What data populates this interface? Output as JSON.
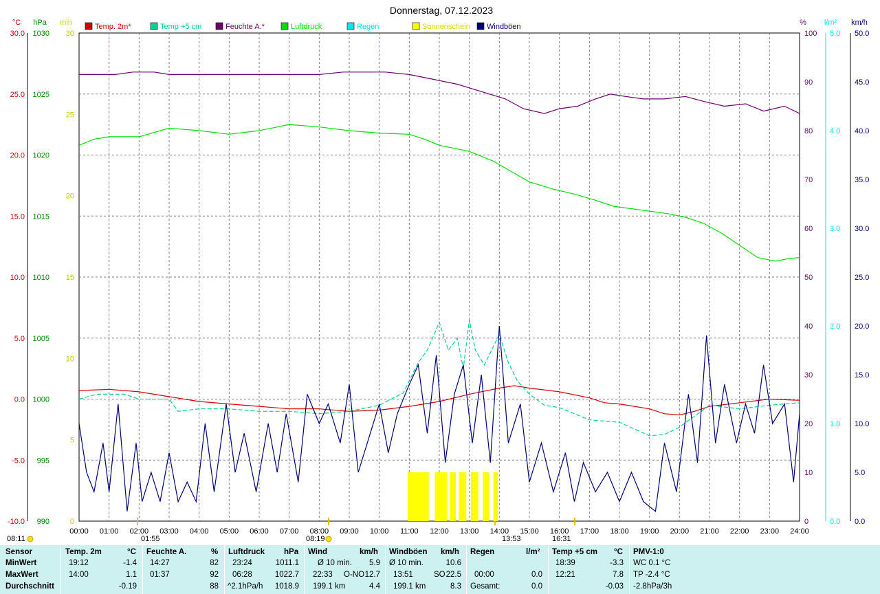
{
  "title": "Donnerstag, 07.12.2023",
  "colors": {
    "temp2m": "#d40000",
    "temp5cm": "#00d28c",
    "feuchte": "#6a006a",
    "luftdruck": "#00e000",
    "regen": "#00e8e8",
    "sonnenschein": "#ffff00",
    "windboeen": "#00007a",
    "grid": "#808080",
    "panel_bg": "#cdf1f1"
  },
  "chart_data": {
    "type": "line",
    "title": "Donnerstag, 07.12.2023",
    "legend": [
      "Temp. 2m*",
      "Temp +5 cm",
      "Feuchte A.*",
      "Luftdruck",
      "Regen",
      "Sonnenschein",
      "Windböen"
    ],
    "x_ticks": [
      "00:00",
      "01:00",
      "02:00",
      "03:00",
      "04:00",
      "05:00",
      "06:00",
      "07:00",
      "08:00",
      "09:00",
      "10:00",
      "11:00",
      "12:00",
      "13:00",
      "14:00",
      "15:00",
      "16:00",
      "17:00",
      "18:00",
      "19:00",
      "20:00",
      "21:00",
      "22:00",
      "23:00",
      "24:00"
    ],
    "axes": {
      "temp_c": {
        "unit": "°C",
        "ticks": [
          "30.0",
          "25.0",
          "20.0",
          "15.0",
          "10.0",
          "5.0",
          "0.0",
          "-5.0",
          "-10.0"
        ],
        "range": [
          -10,
          30
        ]
      },
      "pressure_hpa": {
        "unit": "hPa",
        "ticks": [
          "1030",
          "1025",
          "1020",
          "1015",
          "1010",
          "1005",
          "1000",
          "995",
          "990"
        ],
        "range": [
          990,
          1030
        ]
      },
      "sun_min": {
        "unit": "min",
        "ticks": [
          "30",
          "25",
          "20",
          "15",
          "10",
          "5",
          "0"
        ],
        "range": [
          0,
          30
        ]
      },
      "humidity_pct": {
        "unit": "%",
        "ticks": [
          "100",
          "90",
          "80",
          "70",
          "60",
          "50",
          "40",
          "30",
          "20",
          "10",
          "0"
        ],
        "range": [
          0,
          100
        ]
      },
      "rain_lm2": {
        "unit": "l/m²",
        "ticks": [
          "5.0",
          "4.0",
          "3.0",
          "2.0",
          "1.0",
          "0.0"
        ],
        "range": [
          0,
          5
        ]
      },
      "wind_kmh": {
        "unit": "km/h",
        "ticks": [
          "50.0",
          "45.0",
          "40.0",
          "35.0",
          "30.0",
          "25.0",
          "20.0",
          "15.0",
          "10.0",
          "5.0",
          "0.0"
        ],
        "range": [
          0,
          50
        ]
      }
    },
    "markers": {
      "sunrise": "08:19",
      "sunset": "16:31",
      "sun_max": "13:53",
      "extra": "01:55",
      "start": "08:11"
    },
    "series": [
      {
        "name": "Feuchte A.*",
        "axis": "humidity_pct",
        "points": [
          [
            0,
            91.5
          ],
          [
            1.2,
            91.5
          ],
          [
            1.8,
            92
          ],
          [
            2.5,
            92
          ],
          [
            3,
            91.5
          ],
          [
            4,
            91.5
          ],
          [
            5,
            91.5
          ],
          [
            6,
            91.5
          ],
          [
            7,
            91.5
          ],
          [
            8,
            91.5
          ],
          [
            8.8,
            92
          ],
          [
            10.2,
            92
          ],
          [
            11,
            91.5
          ],
          [
            11.8,
            90.5
          ],
          [
            12.6,
            89.5
          ],
          [
            13.4,
            88
          ],
          [
            14.2,
            86.5
          ],
          [
            14.8,
            84.5
          ],
          [
            15.5,
            83.5
          ],
          [
            16,
            84.5
          ],
          [
            16.6,
            85
          ],
          [
            17.2,
            86.5
          ],
          [
            17.7,
            87.5
          ],
          [
            18.2,
            87
          ],
          [
            18.8,
            86.5
          ],
          [
            19.5,
            86.5
          ],
          [
            20.2,
            87
          ],
          [
            20.8,
            86
          ],
          [
            21.5,
            85
          ],
          [
            22.2,
            85.5
          ],
          [
            22.8,
            84
          ],
          [
            23.5,
            85
          ],
          [
            24,
            83.5
          ]
        ]
      },
      {
        "name": "Luftdruck",
        "axis": "pressure_hpa",
        "points": [
          [
            0,
            1020.8
          ],
          [
            0.5,
            1021.3
          ],
          [
            1,
            1021.5
          ],
          [
            2,
            1021.5
          ],
          [
            3,
            1022.2
          ],
          [
            4,
            1022
          ],
          [
            5,
            1021.7
          ],
          [
            6,
            1022
          ],
          [
            7,
            1022.5
          ],
          [
            8,
            1022.3
          ],
          [
            9,
            1022
          ],
          [
            10,
            1021.8
          ],
          [
            11,
            1021.7
          ],
          [
            11.5,
            1021.3
          ],
          [
            12,
            1020.8
          ],
          [
            13,
            1020.3
          ],
          [
            13.8,
            1019.5
          ],
          [
            14.5,
            1018.5
          ],
          [
            15,
            1017.8
          ],
          [
            15.8,
            1017.2
          ],
          [
            16.5,
            1016.8
          ],
          [
            17.2,
            1016.3
          ],
          [
            17.8,
            1015.8
          ],
          [
            18.4,
            1015.6
          ],
          [
            19,
            1015.4
          ],
          [
            19.6,
            1015.2
          ],
          [
            20.2,
            1014.9
          ],
          [
            20.8,
            1014.4
          ],
          [
            21.4,
            1013.6
          ],
          [
            22,
            1012.6
          ],
          [
            22.6,
            1011.6
          ],
          [
            23.2,
            1011.3
          ],
          [
            23.6,
            1011.5
          ],
          [
            24,
            1011.6
          ]
        ]
      },
      {
        "name": "Temp. 2m*",
        "axis": "temp_c",
        "points": [
          [
            0,
            0.7
          ],
          [
            1,
            0.8
          ],
          [
            2,
            0.6
          ],
          [
            3,
            0.2
          ],
          [
            4,
            -0.2
          ],
          [
            5,
            -0.4
          ],
          [
            6,
            -0.6
          ],
          [
            7,
            -0.8
          ],
          [
            8,
            -0.8
          ],
          [
            9,
            -1
          ],
          [
            10,
            -0.9
          ],
          [
            11,
            -0.6
          ],
          [
            12,
            -0.2
          ],
          [
            13,
            0.4
          ],
          [
            14,
            0.9
          ],
          [
            14.5,
            1.1
          ],
          [
            15,
            0.9
          ],
          [
            16,
            0.6
          ],
          [
            17,
            0.1
          ],
          [
            17.5,
            -0.3
          ],
          [
            18,
            -0.4
          ],
          [
            19,
            -0.8
          ],
          [
            19.5,
            -1.2
          ],
          [
            20,
            -1.3
          ],
          [
            20.5,
            -1
          ],
          [
            21,
            -0.6
          ],
          [
            22,
            -0.3
          ],
          [
            23,
            0
          ],
          [
            24,
            -0.1
          ]
        ]
      },
      {
        "name": "Temp +5 cm",
        "axis": "temp_c",
        "points": [
          [
            0,
            0
          ],
          [
            0.6,
            0.4
          ],
          [
            1.5,
            0.4
          ],
          [
            2,
            0
          ],
          [
            3,
            0
          ],
          [
            3.3,
            -1
          ],
          [
            4,
            -0.8
          ],
          [
            5,
            -0.8
          ],
          [
            6,
            -1
          ],
          [
            7,
            -1
          ],
          [
            8,
            -1.2
          ],
          [
            9,
            -1
          ],
          [
            10,
            -0.5
          ],
          [
            10.8,
            0.5
          ],
          [
            11.3,
            3
          ],
          [
            11.6,
            4
          ],
          [
            12,
            6.3
          ],
          [
            12.3,
            4
          ],
          [
            12.6,
            5
          ],
          [
            12.8,
            2.5
          ],
          [
            13,
            6.5
          ],
          [
            13.2,
            4
          ],
          [
            13.5,
            2.8
          ],
          [
            14,
            5.3
          ],
          [
            14.3,
            3
          ],
          [
            14.6,
            1.5
          ],
          [
            15,
            0.4
          ],
          [
            15.5,
            -0.5
          ],
          [
            16,
            -0.7
          ],
          [
            16.5,
            -1.2
          ],
          [
            17,
            -1.7
          ],
          [
            18,
            -1.9
          ],
          [
            19,
            -3
          ],
          [
            19.5,
            -2.9
          ],
          [
            20,
            -2.3
          ],
          [
            21,
            -0.5
          ],
          [
            22,
            -0.8
          ],
          [
            23,
            -0.5
          ],
          [
            24,
            -0.3
          ]
        ]
      },
      {
        "name": "Windböen",
        "axis": "wind_kmh",
        "points": [
          [
            0,
            10
          ],
          [
            0.25,
            5
          ],
          [
            0.5,
            3
          ],
          [
            0.8,
            8
          ],
          [
            1,
            3
          ],
          [
            1.3,
            12
          ],
          [
            1.6,
            1
          ],
          [
            1.9,
            8
          ],
          [
            2.1,
            2
          ],
          [
            2.4,
            5
          ],
          [
            2.7,
            2
          ],
          [
            3,
            7
          ],
          [
            3.3,
            2
          ],
          [
            3.6,
            4
          ],
          [
            3.9,
            2
          ],
          [
            4.2,
            10
          ],
          [
            4.5,
            3
          ],
          [
            4.9,
            12
          ],
          [
            5.2,
            5
          ],
          [
            5.5,
            9
          ],
          [
            5.9,
            3
          ],
          [
            6.3,
            10
          ],
          [
            6.6,
            5
          ],
          [
            6.9,
            11
          ],
          [
            7.3,
            4
          ],
          [
            7.6,
            13
          ],
          [
            8,
            10
          ],
          [
            8.3,
            12
          ],
          [
            8.7,
            8
          ],
          [
            9,
            14
          ],
          [
            9.3,
            5
          ],
          [
            9.7,
            9
          ],
          [
            10,
            12
          ],
          [
            10.3,
            7
          ],
          [
            10.6,
            11
          ],
          [
            11,
            14
          ],
          [
            11.3,
            16
          ],
          [
            11.6,
            9
          ],
          [
            11.9,
            17
          ],
          [
            12.2,
            6
          ],
          [
            12.5,
            13
          ],
          [
            12.8,
            16
          ],
          [
            13.1,
            8
          ],
          [
            13.4,
            15
          ],
          [
            13.7,
            6
          ],
          [
            14,
            20
          ],
          [
            14.3,
            8
          ],
          [
            14.7,
            12
          ],
          [
            15,
            4
          ],
          [
            15.4,
            8
          ],
          [
            15.8,
            3
          ],
          [
            16.2,
            7
          ],
          [
            16.5,
            2
          ],
          [
            16.8,
            6
          ],
          [
            17.2,
            3
          ],
          [
            17.6,
            5
          ],
          [
            18,
            2
          ],
          [
            18.4,
            5
          ],
          [
            18.8,
            2
          ],
          [
            19.2,
            1
          ],
          [
            19.5,
            8
          ],
          [
            19.9,
            3
          ],
          [
            20.3,
            13
          ],
          [
            20.6,
            6
          ],
          [
            20.9,
            19
          ],
          [
            21.2,
            8
          ],
          [
            21.5,
            14
          ],
          [
            21.9,
            8
          ],
          [
            22.2,
            12
          ],
          [
            22.5,
            9
          ],
          [
            22.8,
            16
          ],
          [
            23.1,
            10
          ],
          [
            23.5,
            12
          ],
          [
            23.8,
            4
          ],
          [
            24,
            11
          ]
        ]
      },
      {
        "name": "Sonnenschein",
        "axis": "sun_min",
        "bars": [
          [
            10.95,
            11.65
          ],
          [
            11.85,
            12.25
          ],
          [
            12.35,
            12.55
          ],
          [
            12.65,
            12.9
          ],
          [
            13.05,
            13.3
          ],
          [
            13.45,
            13.65
          ],
          [
            13.8,
            13.95
          ]
        ],
        "value": 3
      }
    ]
  },
  "stats": {
    "headers": {
      "sensor": "Sensor",
      "temp2m": "Temp. 2m",
      "temp2m_unit": "°C",
      "feuchte": "Feuchte A.",
      "feuchte_unit": "%",
      "luftdruck": "Luftdruck",
      "luftdruck_unit": "hPa",
      "wind": "Wind",
      "wind_unit": "km/h",
      "boeen": "Windböen",
      "boeen_unit": "km/h",
      "regen": "Regen",
      "regen_unit": "l/m²",
      "temp5cm": "Temp +5 cm",
      "temp5cm_unit": "°C",
      "pmv": "PMV-1:0"
    },
    "min": {
      "label": "MinWert",
      "temp2m_time": "19:12",
      "temp2m_val": "-1.4",
      "feuchte_time": "14:27",
      "feuchte_val": "82",
      "luftdruck_time": "23:24",
      "luftdruck_val": "1011.1",
      "wind_label": "Ø 10 min.",
      "wind_val": "5.9",
      "boeen_label": "Ø 10 min.",
      "boeen_val": "10.6",
      "temp5cm_time": "18:39",
      "temp5cm_val": "-3.3",
      "pmv": "WC 0.1 °C"
    },
    "max": {
      "label": "MaxWert",
      "temp2m_time": "14:00",
      "temp2m_val": "1.1",
      "feuchte_time": "01:37",
      "feuchte_val": "92",
      "luftdruck_time": "06:28",
      "luftdruck_val": "1022.7",
      "wind_time": "22:33",
      "wind_dir": "O-NO",
      "wind_val": "12.7",
      "boeen_time": "13:51",
      "boeen_dir": "SO",
      "boeen_val": "22.5",
      "regen_time": "00:00",
      "regen_val": "0.0",
      "temp5cm_time": "12:21",
      "temp5cm_val": "7.8",
      "pmv": "TP -2.4 °C"
    },
    "avg": {
      "label": "Durchschnitt",
      "temp2m_val": "-0.19",
      "feuchte_val": "88",
      "luftdruck_trend": "^2.1hPa/h",
      "luftdruck_val": "1018.9",
      "wind_dist": "199.1 km",
      "wind_val": "4.4",
      "boeen_dist": "199.1 km",
      "boeen_val": "8.3",
      "regen_label": "Gesamt:",
      "regen_val": "0.0",
      "temp5cm_val": "-0.03",
      "pmv": "-2.8hPa/3h"
    }
  }
}
